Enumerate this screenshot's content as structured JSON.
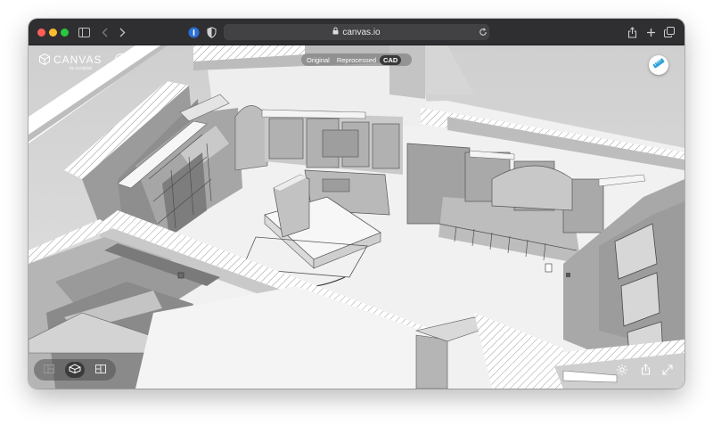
{
  "browser": {
    "url": "canvas.io",
    "toolbar_icons": [
      "sidebar-icon",
      "back-icon",
      "forward-icon",
      "password-manager-icon",
      "shield-icon",
      "lock-icon",
      "reload-icon",
      "share-icon",
      "new-tab-icon",
      "tabs-overview-icon"
    ]
  },
  "app": {
    "brand_name": "CANVAS",
    "brand_sub": "by occipital",
    "info_label": "i",
    "view_modes": [
      {
        "label": "Original",
        "active": false
      },
      {
        "label": "Reprocessed",
        "active": false
      },
      {
        "label": "CAD",
        "active": true
      }
    ],
    "bottom_toolbar": {
      "buttons": [
        "floorplan-icon",
        "3d-view-icon",
        "layout-icon"
      ],
      "active": "3d-view-icon"
    },
    "bottom_right_icons": [
      "settings-icon",
      "share-icon",
      "expand-icon"
    ]
  },
  "colors": {
    "browser_chrome": "#2f2f31",
    "url_bar": "#424245",
    "accent": "#2aa3d8",
    "wall_cut": "#ffffff",
    "floor": "#f2f2f2"
  }
}
